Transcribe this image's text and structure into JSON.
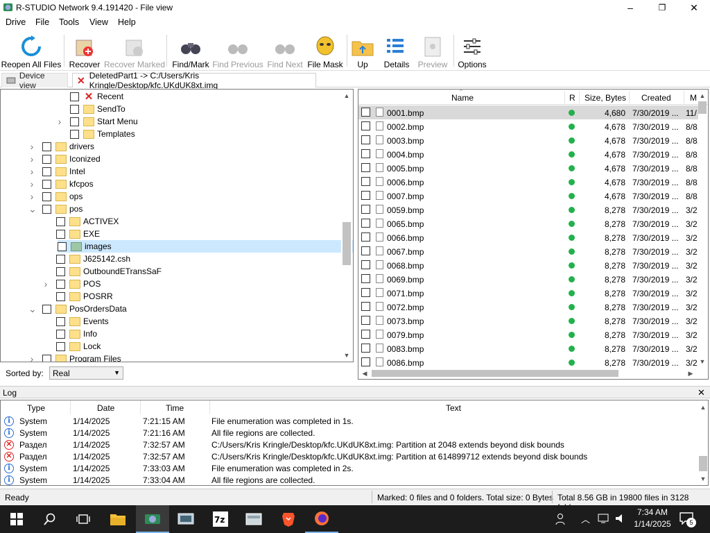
{
  "window": {
    "title": "R-STUDIO Network 9.4.191420 - File view",
    "minimize": "–",
    "maximize": "❐",
    "close": "✕"
  },
  "menu": [
    "Drive",
    "File",
    "Tools",
    "View",
    "Help"
  ],
  "toolbar": [
    {
      "label": "Reopen All Files",
      "icon": "refresh-icon",
      "enabled": true
    },
    {
      "label": "Recover",
      "icon": "recover-icon",
      "enabled": true
    },
    {
      "label": "Recover Marked",
      "icon": "recover-marked-icon",
      "enabled": false
    },
    {
      "label": "Find/Mark",
      "icon": "binoculars-icon",
      "enabled": true
    },
    {
      "label": "Find Previous",
      "icon": "binoculars-prev-icon",
      "enabled": false
    },
    {
      "label": "Find Next",
      "icon": "binoculars-next-icon",
      "enabled": false
    },
    {
      "label": "File Mask",
      "icon": "mask-icon",
      "enabled": true
    },
    {
      "label": "Up",
      "icon": "folder-up-icon",
      "enabled": true
    },
    {
      "label": "Details",
      "icon": "details-icon",
      "enabled": true
    },
    {
      "label": "Preview",
      "icon": "preview-icon",
      "enabled": false
    },
    {
      "label": "Options",
      "icon": "options-icon",
      "enabled": true
    }
  ],
  "tabs": {
    "device": "Device view",
    "file": "DeletedPart1 -> C:/Users/Kris Kringle/Desktop/kfc.UKdUK8xt.img"
  },
  "tree": [
    {
      "label": "Recent",
      "indent": 2,
      "icon": "x",
      "expander": ""
    },
    {
      "label": "SendTo",
      "indent": 2,
      "icon": "folder",
      "expander": ""
    },
    {
      "label": "Start Menu",
      "indent": 2,
      "icon": "folder",
      "expander": ">"
    },
    {
      "label": "Templates",
      "indent": 2,
      "icon": "folder",
      "expander": ""
    },
    {
      "label": "drivers",
      "indent": 0,
      "icon": "folder",
      "expander": ">"
    },
    {
      "label": "Iconized",
      "indent": 0,
      "icon": "folder",
      "expander": ">"
    },
    {
      "label": "Intel",
      "indent": 0,
      "icon": "folder",
      "expander": ">"
    },
    {
      "label": "kfcpos",
      "indent": 0,
      "icon": "folder",
      "expander": ">"
    },
    {
      "label": "ops",
      "indent": 0,
      "icon": "folder",
      "expander": ">"
    },
    {
      "label": "pos",
      "indent": 0,
      "icon": "folder",
      "expander": "v"
    },
    {
      "label": "ACTIVEX",
      "indent": 1,
      "icon": "folder",
      "expander": ""
    },
    {
      "label": "EXE",
      "indent": 1,
      "icon": "folder",
      "expander": ""
    },
    {
      "label": "images",
      "indent": 1,
      "icon": "folder-green",
      "expander": "",
      "selected": true
    },
    {
      "label": "J625142.csh",
      "indent": 1,
      "icon": "folder",
      "expander": ""
    },
    {
      "label": "OutboundETransSaF",
      "indent": 1,
      "icon": "folder",
      "expander": ""
    },
    {
      "label": "POS",
      "indent": 1,
      "icon": "folder",
      "expander": ">"
    },
    {
      "label": "POSRR",
      "indent": 1,
      "icon": "folder",
      "expander": ""
    },
    {
      "label": "PosOrdersData",
      "indent": 0,
      "icon": "folder",
      "expander": "v"
    },
    {
      "label": "Events",
      "indent": 1,
      "icon": "folder",
      "expander": ""
    },
    {
      "label": "Info",
      "indent": 1,
      "icon": "folder",
      "expander": ""
    },
    {
      "label": "Lock",
      "indent": 1,
      "icon": "folder",
      "expander": ""
    },
    {
      "label": "Program Files",
      "indent": 0,
      "icon": "folder",
      "expander": ">"
    }
  ],
  "sort": {
    "label": "Sorted by:",
    "value": "Real"
  },
  "list": {
    "columns": {
      "name": "Name",
      "r": "R",
      "size": "Size, Bytes",
      "created": "Created",
      "modified": "M"
    },
    "rows": [
      {
        "name": "0001.bmp",
        "size": "4,680",
        "created": "7/30/2019 ...",
        "modified": "11/"
      },
      {
        "name": "0002.bmp",
        "size": "4,678",
        "created": "7/30/2019 ...",
        "modified": "8/8,"
      },
      {
        "name": "0003.bmp",
        "size": "4,678",
        "created": "7/30/2019 ...",
        "modified": "8/8,"
      },
      {
        "name": "0004.bmp",
        "size": "4,678",
        "created": "7/30/2019 ...",
        "modified": "8/8,"
      },
      {
        "name": "0005.bmp",
        "size": "4,678",
        "created": "7/30/2019 ...",
        "modified": "8/8,"
      },
      {
        "name": "0006.bmp",
        "size": "4,678",
        "created": "7/30/2019 ...",
        "modified": "8/8,"
      },
      {
        "name": "0007.bmp",
        "size": "4,678",
        "created": "7/30/2019 ...",
        "modified": "8/8,"
      },
      {
        "name": "0059.bmp",
        "size": "8,278",
        "created": "7/30/2019 ...",
        "modified": "3/2"
      },
      {
        "name": "0065.bmp",
        "size": "8,278",
        "created": "7/30/2019 ...",
        "modified": "3/2"
      },
      {
        "name": "0066.bmp",
        "size": "8,278",
        "created": "7/30/2019 ...",
        "modified": "3/2"
      },
      {
        "name": "0067.bmp",
        "size": "8,278",
        "created": "7/30/2019 ...",
        "modified": "3/2"
      },
      {
        "name": "0068.bmp",
        "size": "8,278",
        "created": "7/30/2019 ...",
        "modified": "3/2"
      },
      {
        "name": "0069.bmp",
        "size": "8,278",
        "created": "7/30/2019 ...",
        "modified": "3/2"
      },
      {
        "name": "0071.bmp",
        "size": "8,278",
        "created": "7/30/2019 ...",
        "modified": "3/2"
      },
      {
        "name": "0072.bmp",
        "size": "8,278",
        "created": "7/30/2019 ...",
        "modified": "3/2"
      },
      {
        "name": "0073.bmp",
        "size": "8,278",
        "created": "7/30/2019 ...",
        "modified": "3/2"
      },
      {
        "name": "0079.bmp",
        "size": "8,278",
        "created": "7/30/2019 ...",
        "modified": "3/2"
      },
      {
        "name": "0083.bmp",
        "size": "8,278",
        "created": "7/30/2019 ...",
        "modified": "3/2"
      },
      {
        "name": "0086.bmp",
        "size": "8,278",
        "created": "7/30/2019 ...",
        "modified": "3/2"
      }
    ]
  },
  "log": {
    "title": "Log",
    "columns": {
      "type": "Type",
      "date": "Date",
      "time": "Time",
      "text": "Text"
    },
    "rows": [
      {
        "kind": "info",
        "type": "System",
        "date": "1/14/2025",
        "time": "7:21:15 AM",
        "text": "File enumeration was completed in 1s."
      },
      {
        "kind": "info",
        "type": "System",
        "date": "1/14/2025",
        "time": "7:21:16 AM",
        "text": "All file regions are collected."
      },
      {
        "kind": "error",
        "type": "Раздел",
        "date": "1/14/2025",
        "time": "7:32:57 AM",
        "text": "C:/Users/Kris Kringle/Desktop/kfc.UKdUK8xt.img: Partition at 2048 extends beyond disk bounds"
      },
      {
        "kind": "error",
        "type": "Раздел",
        "date": "1/14/2025",
        "time": "7:32:57 AM",
        "text": "C:/Users/Kris Kringle/Desktop/kfc.UKdUK8xt.img: Partition at 614899712 extends beyond disk bounds"
      },
      {
        "kind": "info",
        "type": "System",
        "date": "1/14/2025",
        "time": "7:33:03 AM",
        "text": "File enumeration was completed in 2s."
      },
      {
        "kind": "info",
        "type": "System",
        "date": "1/14/2025",
        "time": "7:33:04 AM",
        "text": "All file regions are collected."
      }
    ]
  },
  "status": {
    "ready": "Ready",
    "marked": "Marked: 0 files and 0 folders. Total size: 0 Bytes",
    "total": "Total 8.56 GB in 19800 files in 3128 folders"
  },
  "taskbar": {
    "time": "7:34 AM",
    "date": "1/14/2025",
    "notifications": "5"
  }
}
